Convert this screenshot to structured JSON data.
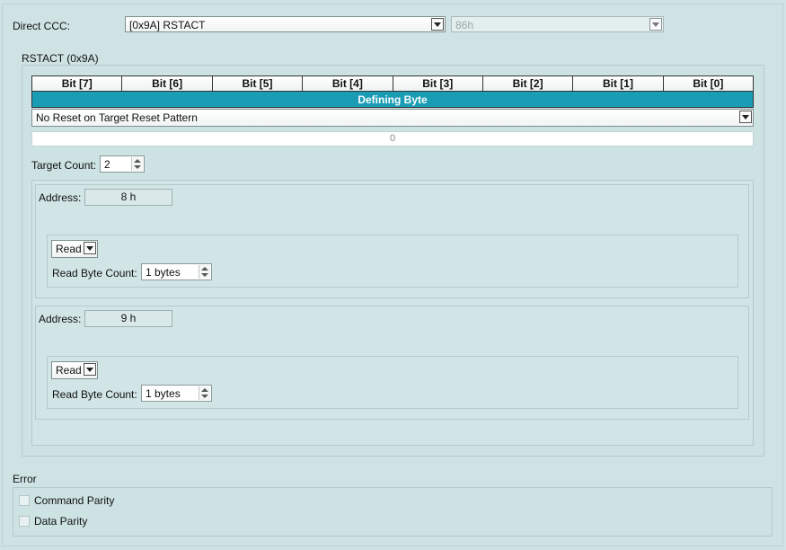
{
  "direct_ccc": {
    "label": "Direct CCC:",
    "selected": "[0x9A] RSTACT",
    "code_value": "86h"
  },
  "rstact": {
    "group_label": "RSTACT (0x9A)",
    "bits": [
      "Bit [7]",
      "Bit [6]",
      "Bit [5]",
      "Bit [4]",
      "Bit [3]",
      "Bit [2]",
      "Bit [1]",
      "Bit [0]"
    ],
    "defining_byte_label": "Defining Byte",
    "defining_byte_selected": "No Reset on Target Reset Pattern",
    "defining_byte_value": "0",
    "target_count_label": "Target Count:",
    "target_count_value": "2",
    "targets": [
      {
        "address_label": "Address:",
        "address_value": "8 h",
        "operation": "Read",
        "byte_count_label": "Read Byte Count:",
        "byte_count_value": "1 bytes"
      },
      {
        "address_label": "Address:",
        "address_value": "9 h",
        "operation": "Read",
        "byte_count_label": "Read Byte Count:",
        "byte_count_value": "1 bytes"
      }
    ]
  },
  "error": {
    "label": "Error",
    "options": [
      {
        "label": "Command Parity",
        "checked": false
      },
      {
        "label": "Data Parity",
        "checked": false
      }
    ]
  },
  "colors": {
    "background": "#cfe3e4",
    "defining_byte_bar": "#1a9cb4"
  }
}
